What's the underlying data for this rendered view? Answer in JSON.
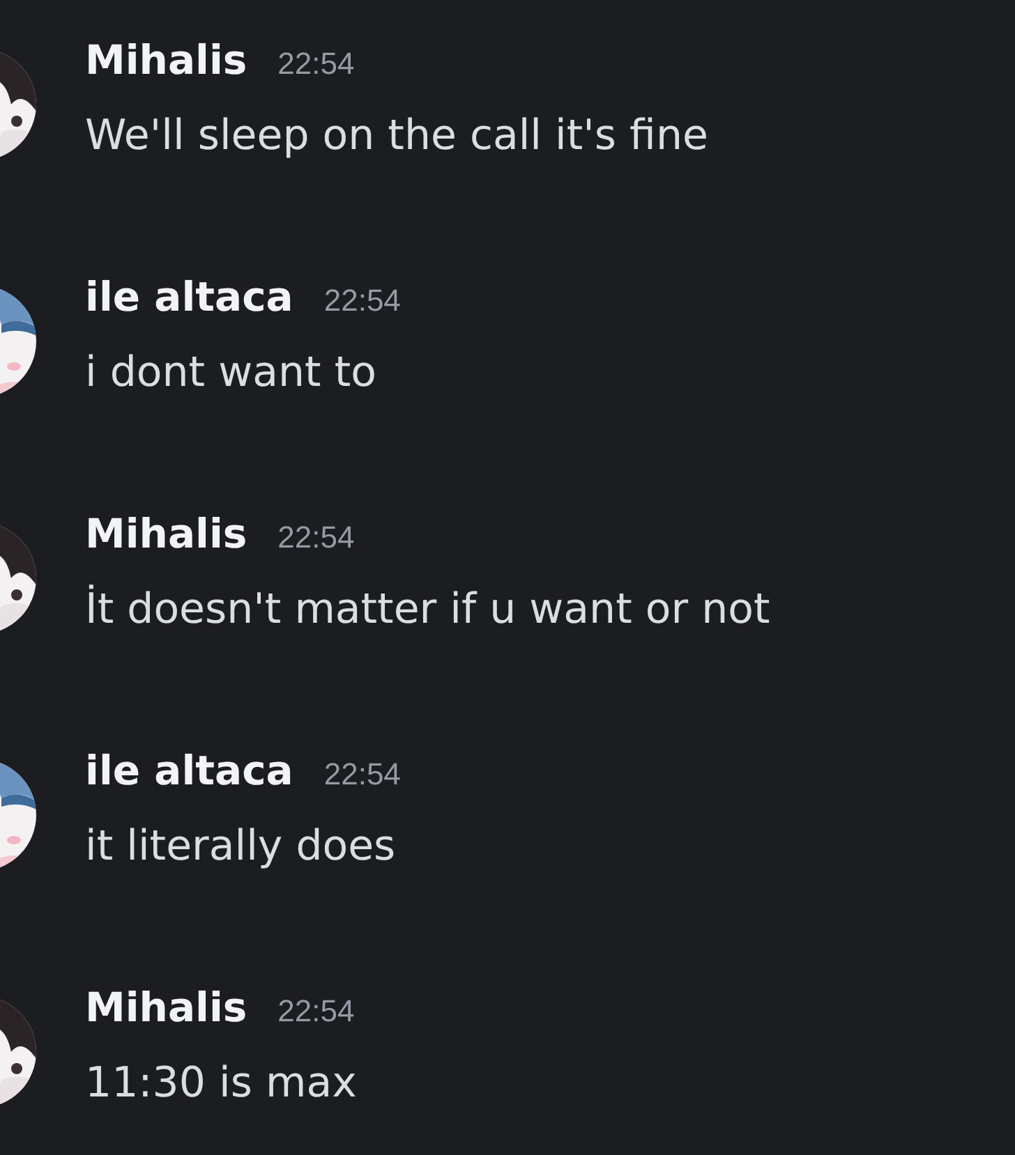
{
  "messages": [
    {
      "kind": "hair",
      "author": "Mihalis",
      "time": "22:54",
      "text": "We'll sleep on the call it's fine"
    },
    {
      "kind": "hat",
      "author": "ile altaca",
      "time": "22:54",
      "text": "i dont want to"
    },
    {
      "kind": "hair",
      "author": "Mihalis",
      "time": "22:54",
      "text": "İt doesn't matter if u want or not"
    },
    {
      "kind": "hat",
      "author": "ile altaca",
      "time": "22:54",
      "text": "it literally does"
    },
    {
      "kind": "hair",
      "author": "Mihalis",
      "time": "22:54",
      "text": "11:30 is max"
    }
  ]
}
